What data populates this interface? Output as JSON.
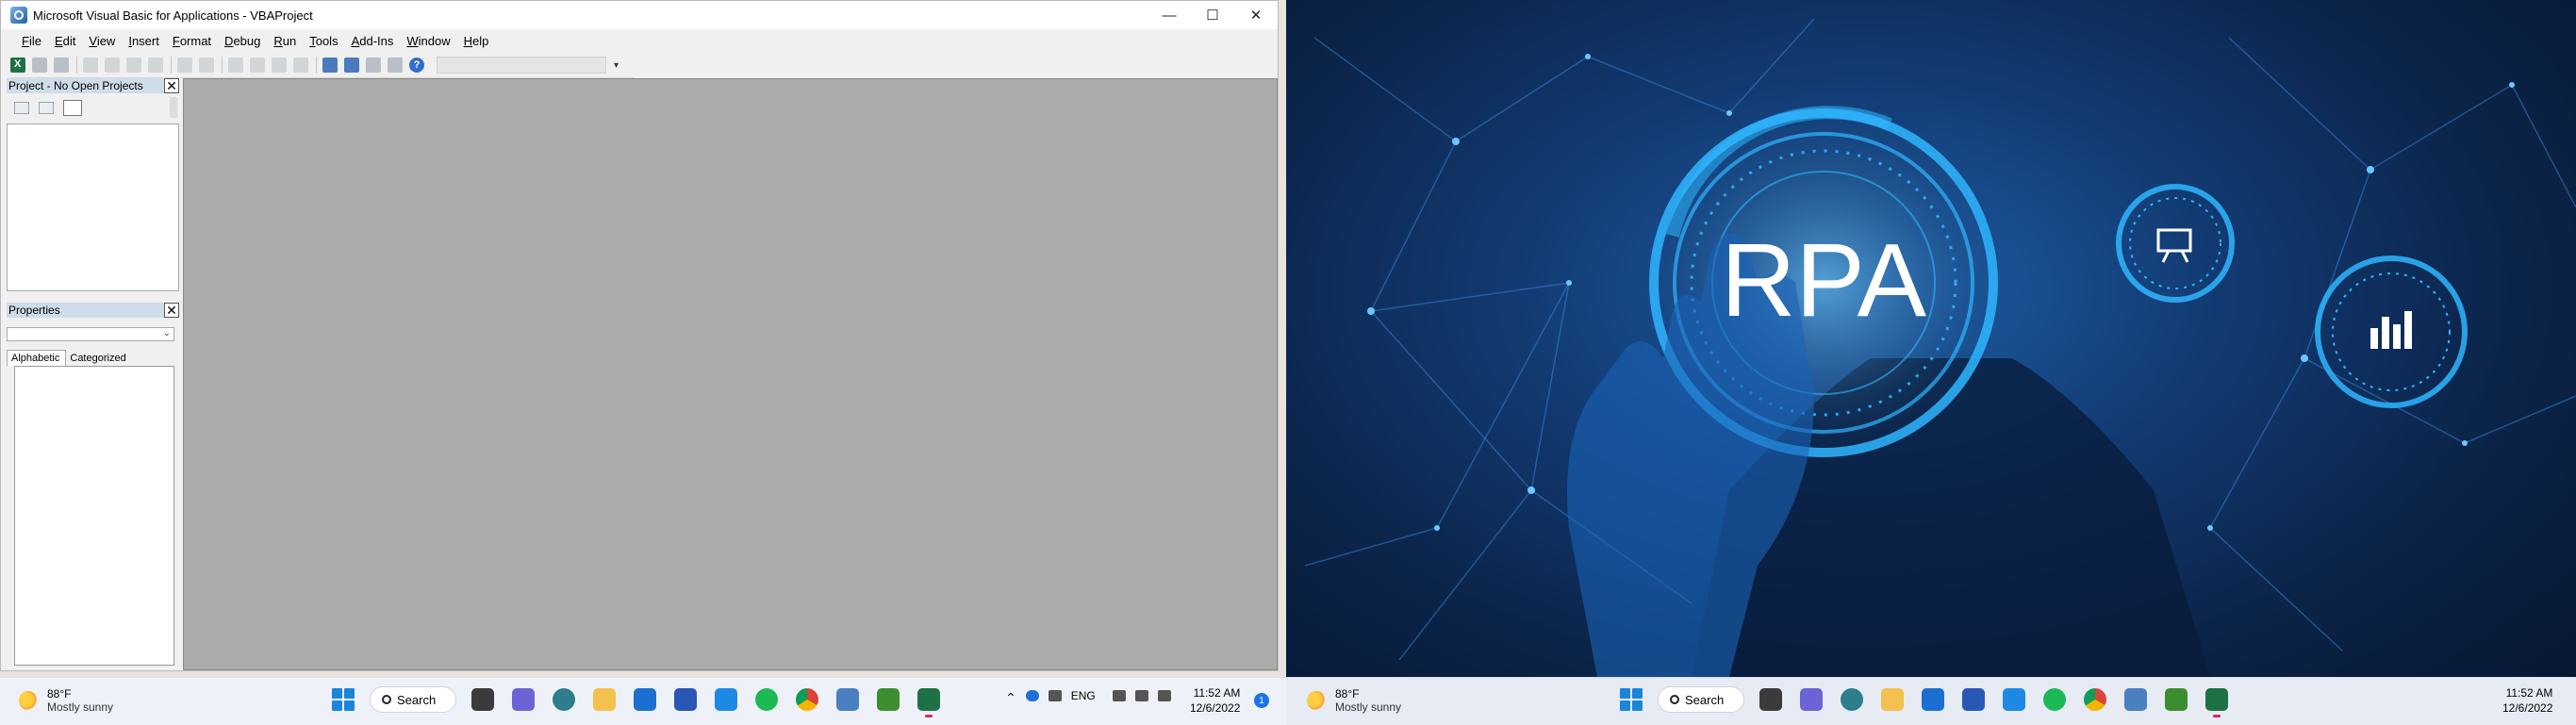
{
  "vba_window": {
    "title": "Microsoft Visual Basic for Applications - VBAProject",
    "controls": {
      "minimize": "—",
      "maximize": "☐",
      "close": "✕"
    },
    "menu": [
      "File",
      "Edit",
      "View",
      "Insert",
      "Format",
      "Debug",
      "Run",
      "Tools",
      "Add-Ins",
      "Window",
      "Help"
    ],
    "toolbar": {
      "help_glyph": "?",
      "overflow_glyph": "▾"
    },
    "project_pane": {
      "title": "Project - No Open Projects",
      "close_glyph": "✕"
    },
    "properties_pane": {
      "title": "Properties",
      "close_glyph": "✕",
      "tabs": [
        "Alphabetic",
        "Categorized"
      ],
      "active_tab": "Alphabetic"
    }
  },
  "wallpaper": {
    "center_text": "RPA",
    "accent": "#2fb6ff"
  },
  "taskbar_left": {
    "weather": {
      "temp": "88°F",
      "condition": "Mostly sunny"
    },
    "search_label": "Search",
    "tray": {
      "language": "ENG",
      "time": "11:52 AM",
      "date": "12/6/2022",
      "badge": "1"
    }
  },
  "taskbar_right": {
    "weather": {
      "temp": "88°F",
      "condition": "Mostly sunny"
    },
    "search_label": "Search",
    "tray": {
      "time": "11:52 AM",
      "date": "12/6/2022"
    }
  },
  "taskbar_apps": [
    "task-view",
    "teams-chat",
    "contacts",
    "file-explorer",
    "mail",
    "store",
    "skype",
    "spotify",
    "chrome",
    "notepad",
    "media-player",
    "excel"
  ]
}
